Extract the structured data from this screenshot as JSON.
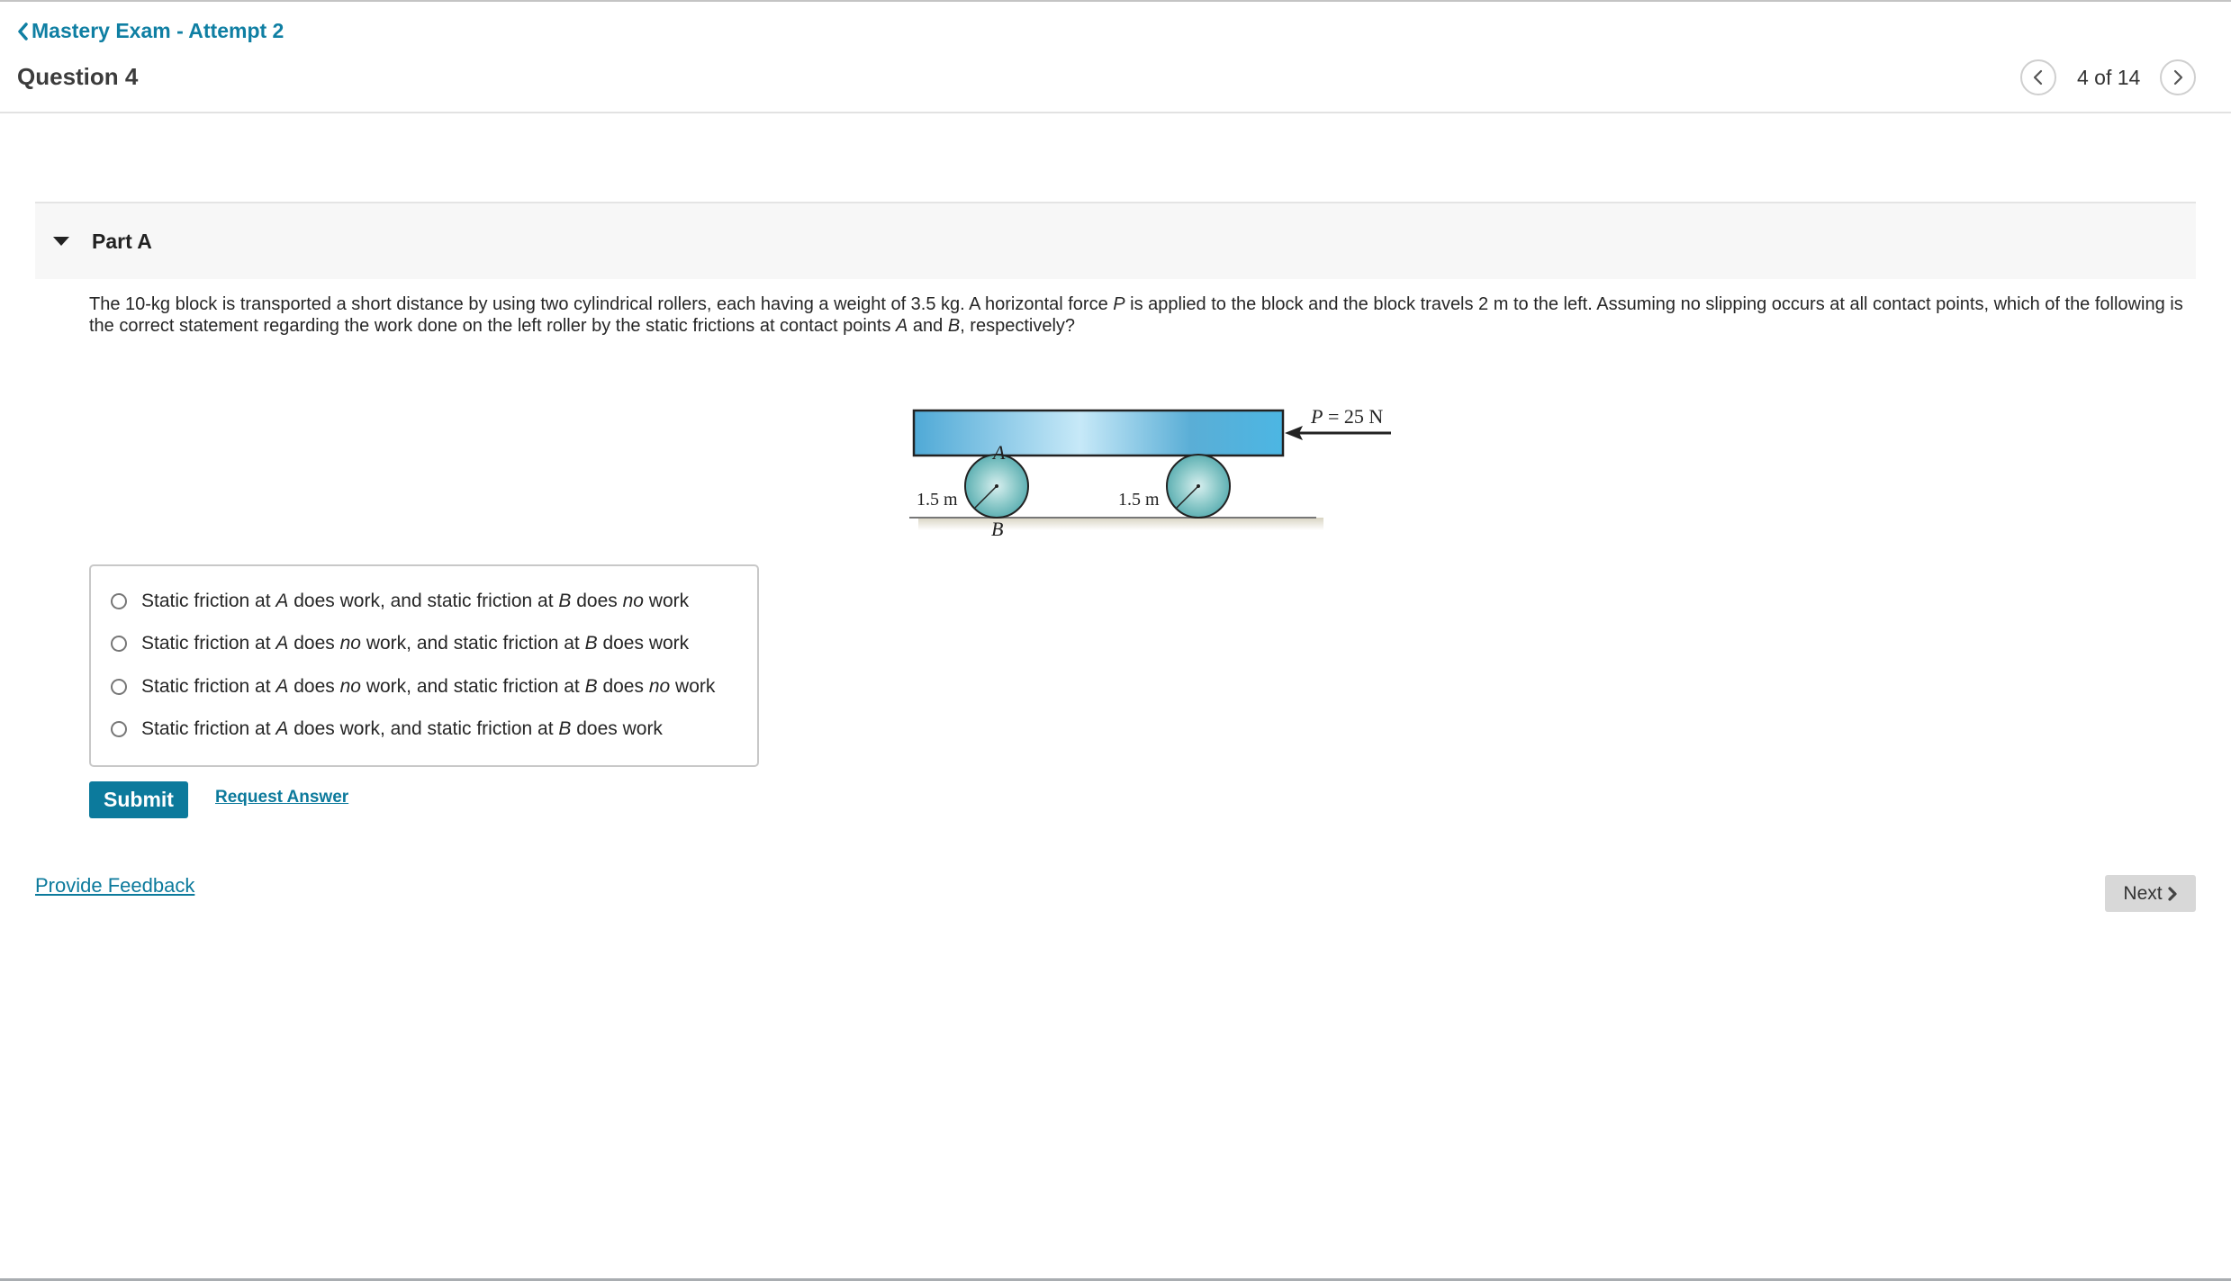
{
  "header": {
    "back_link": "Mastery Exam - Attempt 2",
    "question_title": "Question 4",
    "pager": {
      "current": 4,
      "total": 14,
      "label": "4 of 14"
    }
  },
  "part": {
    "label": "Part A",
    "expanded": true
  },
  "prompt": {
    "segments": [
      {
        "text": "The 10-kg block is transported a short distance by using two cylindrical rollers, each having a weight of 3.5 kg. A horizontal force ",
        "italic": false
      },
      {
        "text": "P",
        "italic": true
      },
      {
        "text": " is applied to the block and the block travels 2 m to the left. Assuming no slipping occurs at all contact points, which of the following is the correct statement regarding the work done on the left roller by the static frictions at contact points ",
        "italic": false
      },
      {
        "text": "A",
        "italic": true
      },
      {
        "text": " and ",
        "italic": false
      },
      {
        "text": "B",
        "italic": true
      },
      {
        "text": ", respectively?",
        "italic": false
      }
    ]
  },
  "diagram": {
    "force_label_var": "P",
    "force_label_value": " = 25 N",
    "left_radius_label": "1.5 m",
    "right_radius_label": "1.5 m",
    "point_a": "A",
    "point_b": "B",
    "colors": {
      "block": "#5bb3dc",
      "roller": "#7fc3c6",
      "ground": "#8d8d8d"
    }
  },
  "choices": [
    {
      "segments": [
        {
          "t": "Static friction at ",
          "i": false
        },
        {
          "t": "A",
          "i": true
        },
        {
          "t": " does work, and static friction at ",
          "i": false
        },
        {
          "t": "B",
          "i": true
        },
        {
          "t": " does ",
          "i": false
        },
        {
          "t": "no",
          "i": true
        },
        {
          "t": " work",
          "i": false
        }
      ],
      "selected": false
    },
    {
      "segments": [
        {
          "t": "Static friction at ",
          "i": false
        },
        {
          "t": "A",
          "i": true
        },
        {
          "t": " does ",
          "i": false
        },
        {
          "t": "no",
          "i": true
        },
        {
          "t": " work, and static friction at ",
          "i": false
        },
        {
          "t": "B",
          "i": true
        },
        {
          "t": " does work",
          "i": false
        }
      ],
      "selected": false
    },
    {
      "segments": [
        {
          "t": "Static friction at ",
          "i": false
        },
        {
          "t": "A",
          "i": true
        },
        {
          "t": " does ",
          "i": false
        },
        {
          "t": "no",
          "i": true
        },
        {
          "t": " work, and static friction at ",
          "i": false
        },
        {
          "t": "B",
          "i": true
        },
        {
          "t": " does ",
          "i": false
        },
        {
          "t": "no",
          "i": true
        },
        {
          "t": " work",
          "i": false
        }
      ],
      "selected": false
    },
    {
      "segments": [
        {
          "t": "Static friction at ",
          "i": false
        },
        {
          "t": "A",
          "i": true
        },
        {
          "t": " does work, and static friction at ",
          "i": false
        },
        {
          "t": "B",
          "i": true
        },
        {
          "t": " does work",
          "i": false
        }
      ],
      "selected": false
    }
  ],
  "actions": {
    "submit": "Submit",
    "request_answer": "Request Answer"
  },
  "footer": {
    "feedback": "Provide Feedback",
    "next": "Next"
  },
  "theme": {
    "accent": "#0c7a9c",
    "link": "#0f7fa3",
    "panel_bg": "#f7f7f7",
    "next_bg": "#d8d8d8"
  }
}
